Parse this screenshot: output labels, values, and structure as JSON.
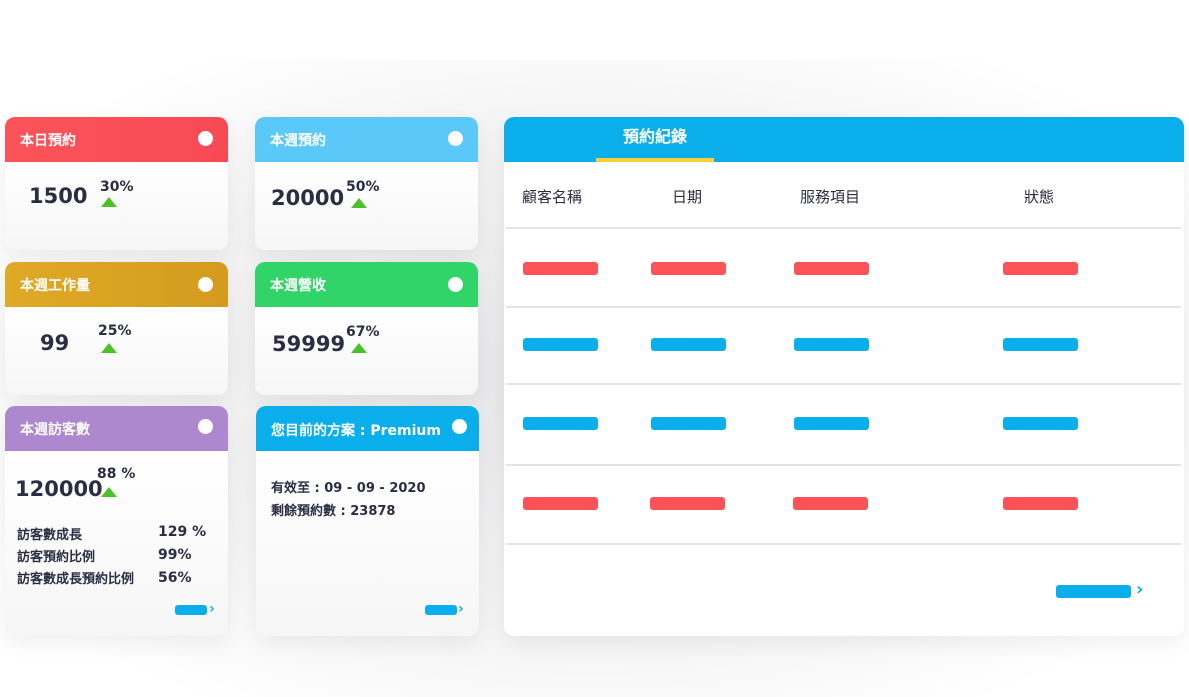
{
  "stats": {
    "today": {
      "title": "本日預約",
      "value": "1500",
      "percent": "30%",
      "color": "#fc5359"
    },
    "week": {
      "title": "本週預約",
      "value": "20000",
      "percent": "50%",
      "color": "#5bc8fa"
    },
    "workload": {
      "title": "本週工作量",
      "value": "99",
      "percent": "25%",
      "color": "#dca524"
    },
    "revenue": {
      "title": "本週營收",
      "value": "59999",
      "percent": "67%",
      "color": "#31d468"
    },
    "visitors": {
      "title": "本週訪客數",
      "value": "120000",
      "percent": "88 %",
      "color": "#ad88cf",
      "rows": [
        {
          "label": "訪客數成長",
          "value": "129 %"
        },
        {
          "label": "訪客預約比例",
          "value": "99%"
        },
        {
          "label": "訪客數成長預約比例",
          "value": "56%"
        }
      ]
    }
  },
  "plan": {
    "title": "您目前的方案 : Premium",
    "valid_until": "有效至 : 09 - 09 - 2020",
    "remaining": "剩餘預約數 : 23878",
    "color": "#0aaeeb"
  },
  "records": {
    "tab_label": "預約紀錄",
    "columns": [
      "顧客名稱",
      "日期",
      "服務項目",
      "狀態"
    ],
    "rows": [
      {
        "status_color": "#fc5359"
      },
      {
        "status_color": "#0aaeeb"
      },
      {
        "status_color": "#0aaeeb"
      },
      {
        "status_color": "#fc5359"
      }
    ]
  },
  "icons": {
    "more": "chevron-right-icon",
    "trend": "triangle-up-icon",
    "card_dot": "circle-dot-icon"
  },
  "colors": {
    "accent": "#0aaeeb",
    "up": "#4cc22a",
    "tab_underline": "#f7d038",
    "text": "#2b2d42"
  }
}
